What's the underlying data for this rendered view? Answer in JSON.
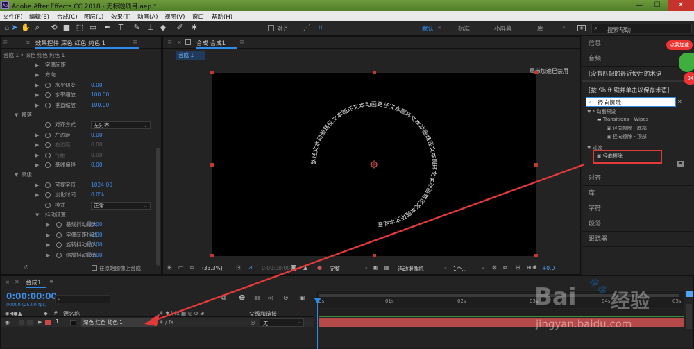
{
  "app": {
    "icon_label": "Ae",
    "title": "Adobe After Effects CC 2018 - 无标题项目.aep *",
    "min": "—",
    "max": "☐",
    "close": "✕"
  },
  "menu": [
    "文件(F)",
    "编辑(E)",
    "合成(C)",
    "图层(L)",
    "效果(T)",
    "动画(A)",
    "视图(V)",
    "窗口",
    "帮助(H)"
  ],
  "toolbar": {
    "align_label": "对齐",
    "workspaces": [
      "默认",
      "标准",
      "小屏幕",
      "库"
    ],
    "search_placeholder": "搜索帮助"
  },
  "effect_controls": {
    "tab_label": "效果控件 深色 红色 纯色 1",
    "breadcrumb": "合成 1 • 深色 红色 纯色 1",
    "properties": [
      {
        "label": "字偶间距",
        "indent": 1,
        "tri": true,
        "sw": false,
        "value": ""
      },
      {
        "label": "方向",
        "indent": 1,
        "tri": true,
        "sw": false,
        "value": ""
      },
      {
        "label": "水平切变",
        "indent": 1,
        "tri": true,
        "sw": true,
        "value": "0.00"
      },
      {
        "label": "水平缩放",
        "indent": 1,
        "tri": true,
        "sw": true,
        "value": "100.00"
      },
      {
        "label": "垂直缩放",
        "indent": 1,
        "tri": true,
        "sw": true,
        "value": "100.00"
      },
      {
        "label": "段落",
        "indent": 0,
        "tri": "open",
        "sw": false,
        "value": ""
      },
      {
        "label": "对齐方式",
        "indent": 1,
        "tri": false,
        "sw": true,
        "value": "",
        "dropdown": "左对齐"
      },
      {
        "label": "左边距",
        "indent": 1,
        "tri": true,
        "sw": true,
        "value": "0.00"
      },
      {
        "label": "右边距",
        "indent": 1,
        "tri": true,
        "sw": true,
        "value": "0.00",
        "dim": true
      },
      {
        "label": "行距",
        "indent": 1,
        "tri": true,
        "sw": true,
        "value": "0.00",
        "dim": true
      },
      {
        "label": "基线偏移",
        "indent": 1,
        "tri": true,
        "sw": true,
        "value": "0.00"
      },
      {
        "label": "高级",
        "indent": 0,
        "tri": "open",
        "sw": false,
        "value": ""
      },
      {
        "label": "可视字符",
        "indent": 1,
        "tri": true,
        "sw": true,
        "value": "1024.00"
      },
      {
        "label": "淡化时间",
        "indent": 1,
        "tri": true,
        "sw": true,
        "value": "0.0%"
      },
      {
        "label": "模式",
        "indent": 1,
        "tri": false,
        "sw": true,
        "value": "",
        "dropdown": "正常"
      },
      {
        "label": "抖动设置",
        "indent": 1,
        "tri": "open",
        "sw": false,
        "value": ""
      },
      {
        "label": "基线抖动最大",
        "indent": 2,
        "tri": true,
        "sw": true,
        "value": "0.00"
      },
      {
        "label": "字偶间距抖动",
        "indent": 2,
        "tri": true,
        "sw": true,
        "value": "0.00"
      },
      {
        "label": "旋转抖动最大",
        "indent": 2,
        "tri": true,
        "sw": true,
        "value": "0.00"
      },
      {
        "label": "缩放抖动最大",
        "indent": 2,
        "tri": true,
        "sw": true,
        "value": "0.00"
      }
    ],
    "checkbox_label": "在原始图像上合成"
  },
  "composition": {
    "tab_label": "合成 合成1",
    "subtab": "合成 1",
    "status_text": "显示加速已禁用",
    "path_text": "路径文本动画路径文本圆环文本动画路径文本圆环文本动画路径文本圆环文本动画路径文本圆环文本动画",
    "zoom": "(33.3%)",
    "timecode": "0:00:00:00",
    "resolution": "完整",
    "camera": "活动摄像机",
    "views": "1个...",
    "exposure": "+0.0"
  },
  "right_panel": {
    "items_top": [
      "信息",
      "音频"
    ],
    "no_match": "[没有匹配的最近使用的术语]",
    "shift_hint": "[按 Shift 键并单击以保存术语]",
    "search_value": "径向擦除",
    "tree": [
      {
        "label": "* 动画预设",
        "indent": 0,
        "icon": "tri"
      },
      {
        "label": "Transitions - Wipes",
        "indent": 1,
        "icon": "folder"
      },
      {
        "label": "径向擦除 - 底部",
        "indent": 2,
        "icon": "preset"
      },
      {
        "label": "径向擦除 - 顶部",
        "indent": 2,
        "icon": "preset"
      },
      {
        "label": "过渡",
        "indent": 0,
        "icon": "tri"
      },
      {
        "label": "径向擦除",
        "indent": 1,
        "icon": "preset"
      }
    ],
    "items_bottom": [
      "对齐",
      "库",
      "字符",
      "段落",
      "跟踪器"
    ],
    "badge_text": "点我加速",
    "badge_number": "94"
  },
  "timeline": {
    "tab_label": "合成1",
    "timecode": "0:00:00:00",
    "fps": "00000 (25.00 fps)",
    "search_placeholder": "",
    "col_source": "源名称",
    "col_parent": "父级和链接",
    "ruler": [
      "0s",
      "01s",
      "02s",
      "03s",
      "04s",
      "05s"
    ],
    "layer": {
      "index": "1",
      "name": "深色 红色 纯色 1",
      "parent": "无"
    }
  },
  "watermark": {
    "logo": "Bai",
    "logo_cn": "经验",
    "url": "jingyan.baidu.com"
  }
}
